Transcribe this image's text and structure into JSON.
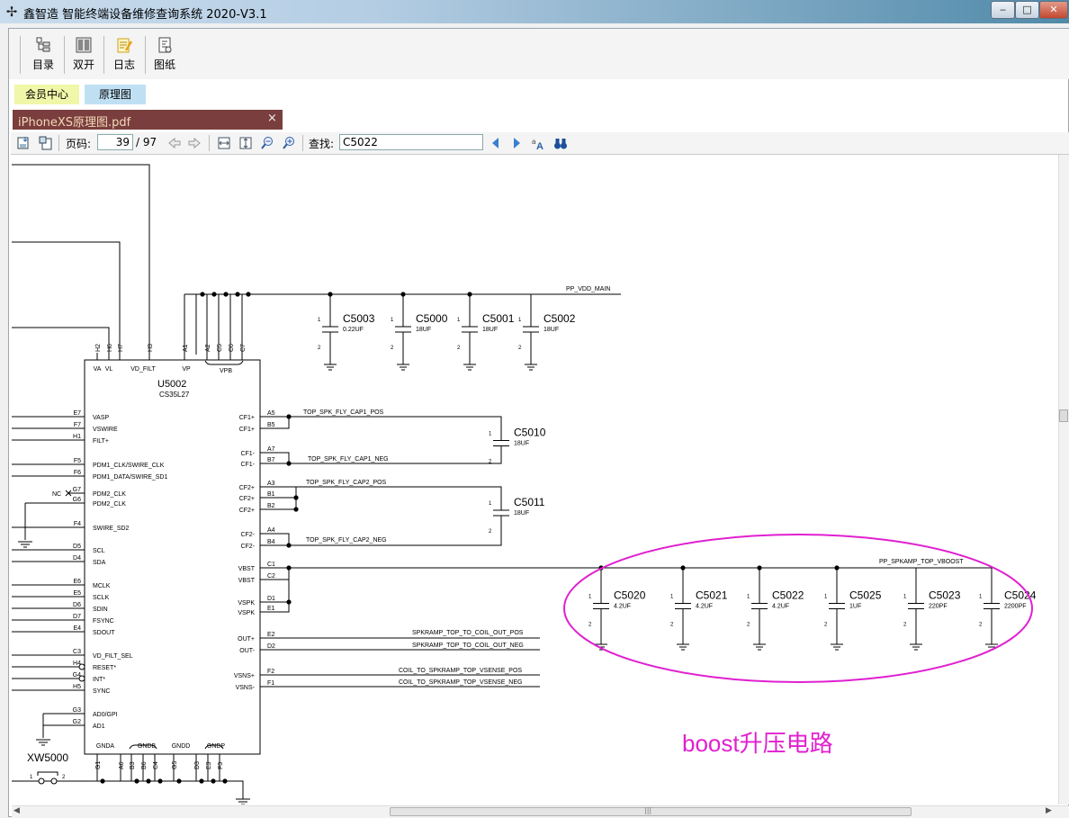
{
  "window": {
    "title": "鑫智造 智能终端设备维修查询系统 2020-V3.1",
    "min_label": "‒",
    "max_label": "□",
    "close_label": "✕"
  },
  "toolbar": {
    "catalog": "目录",
    "dual": "双开",
    "log": "日志",
    "drawing": "图纸"
  },
  "tabs": {
    "member": "会员中心",
    "schematic": "原理图"
  },
  "document_tab": {
    "title": "iPhoneXS原理图.pdf",
    "close": "×"
  },
  "pdf_toolbar": {
    "page_label": "页码:",
    "page_value": "39",
    "page_total": "/ 97",
    "find_label": "查找:",
    "find_value": "C5022"
  },
  "schematic": {
    "chip_ref": "U5002",
    "chip_part": "CS35L27",
    "top_pins": [
      {
        "num": "H2",
        "label": "VA"
      },
      {
        "num": "H6",
        "label": "VL"
      },
      {
        "num": "H7",
        "label": "VD_FILT"
      },
      {
        "num": "H3",
        "label": "VP"
      },
      {
        "num": "A1",
        "label": ""
      },
      {
        "num": "A2",
        "label": ""
      },
      {
        "num": "C5",
        "label": ""
      },
      {
        "num": "C6",
        "label": ""
      },
      {
        "num": "C7",
        "label": ""
      }
    ],
    "vpb_label": "VPB",
    "left_pins": [
      {
        "num": "E7",
        "label": "VASP"
      },
      {
        "num": "F7",
        "label": "VSWIRE"
      },
      {
        "num": "H1",
        "label": "FILT+"
      },
      {
        "num": "F5",
        "label": "PDM1_CLK/SWIRE_CLK"
      },
      {
        "num": "F6",
        "label": "PDM1_DATA/SWIRE_SD1"
      },
      {
        "num": "G7",
        "label": "PDM2_CLK"
      },
      {
        "num": "G6",
        "label": "PDM2_CLK"
      },
      {
        "num": "F4",
        "label": "SWIRE_SD2"
      },
      {
        "num": "D5",
        "label": "SCL"
      },
      {
        "num": "D4",
        "label": "SDA"
      },
      {
        "num": "E6",
        "label": "MCLK"
      },
      {
        "num": "E5",
        "label": "SCLK"
      },
      {
        "num": "D6",
        "label": "SDIN"
      },
      {
        "num": "D7",
        "label": "FSYNC"
      },
      {
        "num": "E4",
        "label": "SDOUT"
      },
      {
        "num": "C3",
        "label": "VD_FILT_SEL"
      },
      {
        "num": "H4",
        "label": "RESET*"
      },
      {
        "num": "G4",
        "label": "INT*"
      },
      {
        "num": "H5",
        "label": "SYNC"
      },
      {
        "num": "G3",
        "label": "AD0/GPI"
      },
      {
        "num": "G2",
        "label": "AD1"
      }
    ],
    "nc_label": "NC",
    "right_pins": [
      {
        "num": "A5",
        "label": "CF1+"
      },
      {
        "num": "B5",
        "label": "CF1+"
      },
      {
        "num": "A7",
        "label": "CF1-"
      },
      {
        "num": "B7",
        "label": "CF1-"
      },
      {
        "num": "A3",
        "label": "CF2+"
      },
      {
        "num": "B1",
        "label": "CF2+"
      },
      {
        "num": "B2",
        "label": "CF2+"
      },
      {
        "num": "A4",
        "label": "CF2-"
      },
      {
        "num": "B4",
        "label": "CF2-"
      },
      {
        "num": "C1",
        "label": "VBST"
      },
      {
        "num": "C2",
        "label": "VBST"
      },
      {
        "num": "D1",
        "label": "VSPK"
      },
      {
        "num": "E1",
        "label": "VSPK"
      },
      {
        "num": "E2",
        "label": "OUT+"
      },
      {
        "num": "D2",
        "label": "OUT-"
      },
      {
        "num": "F2",
        "label": "VSNS+"
      },
      {
        "num": "F1",
        "label": "VSNS-"
      }
    ],
    "bottom_groups": [
      {
        "label": "GNDA",
        "pins": [
          "G1"
        ]
      },
      {
        "label": "GNDB",
        "pins": [
          "A6",
          "B3",
          "B6",
          "C4"
        ]
      },
      {
        "label": "GNDD",
        "pins": [
          "G5"
        ]
      },
      {
        "label": "GNDP",
        "pins": [
          "D3",
          "E3",
          "F3"
        ]
      }
    ],
    "nets": {
      "vdd_main": "PP_VDD_MAIN",
      "cap1_pos": "TOP_SPK_FLY_CAP1_POS",
      "cap1_neg": "TOP_SPK_FLY_CAP1_NEG",
      "cap2_pos": "TOP_SPK_FLY_CAP2_POS",
      "cap2_neg": "TOP_SPK_FLY_CAP2_NEG",
      "vboost": "PP_SPKAMP_TOP_VBOOST",
      "out_pos": "SPKRAMP_TOP_TO_COIL_OUT_POS",
      "out_neg": "SPKRAMP_TOP_TO_COIL_OUT_NEG",
      "vsense_pos": "COIL_TO_SPKRAMP_TOP_VSENSE_POS",
      "vsense_neg": "COIL_TO_SPKRAMP_TOP_VSENSE_NEG"
    },
    "caps_vdd": [
      {
        "ref": "C5003",
        "value": "0.22UF"
      },
      {
        "ref": "C5000",
        "value": "18UF"
      },
      {
        "ref": "C5001",
        "value": "18UF"
      },
      {
        "ref": "C5002",
        "value": "18UF"
      }
    ],
    "caps_fly": [
      {
        "ref": "C5010",
        "value": "18UF"
      },
      {
        "ref": "C5011",
        "value": "18UF"
      }
    ],
    "caps_boost": [
      {
        "ref": "C5020",
        "value": "4.2UF"
      },
      {
        "ref": "C5021",
        "value": "4.2UF"
      },
      {
        "ref": "C5022",
        "value": "4.2UF"
      },
      {
        "ref": "C5025",
        "value": "1UF"
      },
      {
        "ref": "C5023",
        "value": "220PF"
      },
      {
        "ref": "C5024",
        "value": "2200PF"
      }
    ],
    "pin1": "1",
    "pin2": "2",
    "xw_ref": "XW5000",
    "annotation": "boost升压电路",
    "annotation_color": "#e020d0"
  }
}
